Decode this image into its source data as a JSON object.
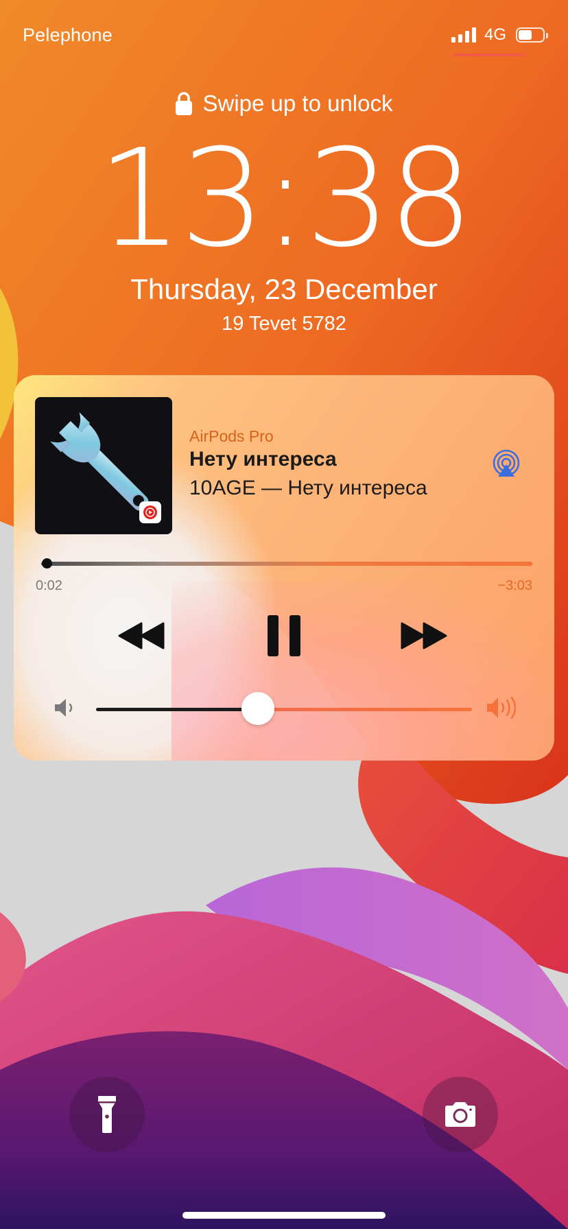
{
  "status_bar": {
    "carrier": "Pelephone",
    "network": "4G",
    "signal_bars": 4,
    "battery_level": 0.55
  },
  "lock_screen": {
    "unlock_hint": "Swipe up to unlock",
    "time": "13:38",
    "date": "Thursday, 23 December",
    "hebrew_date": "19 Tevet 5782"
  },
  "now_playing": {
    "output_device": "AirPods Pro",
    "title": "Нету интереса",
    "subtitle": "10AGE — Нету интереса",
    "elapsed": "0:02",
    "remaining": "−3:03",
    "progress": 0.011,
    "volume": 0.43,
    "artwork_icon": "wrench-icon",
    "app_badge_icon": "youtube-music-icon",
    "controls": {
      "previous_icon": "rewind-icon",
      "play_pause_icon": "pause-icon",
      "next_icon": "fast-forward-icon",
      "airplay_icon": "airplay-audio-icon"
    },
    "colors": {
      "accent": "#d8621b",
      "track_active": "#f5733a"
    }
  },
  "quick_actions": {
    "left_icon": "flashlight-icon",
    "right_icon": "camera-icon"
  }
}
